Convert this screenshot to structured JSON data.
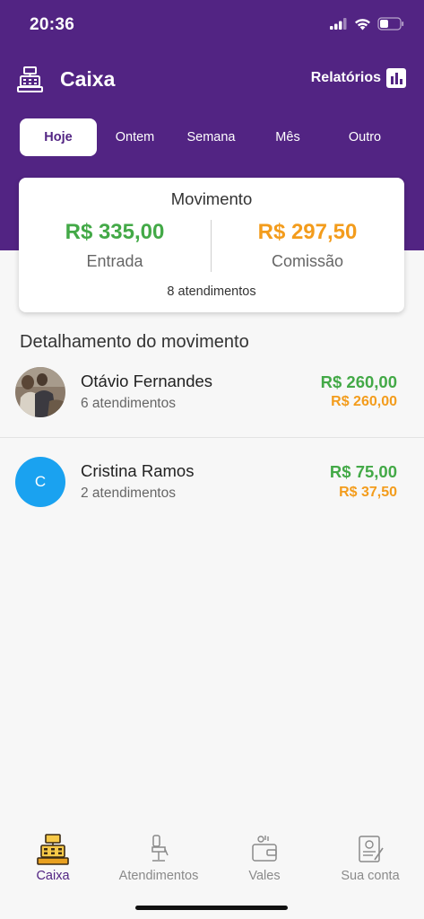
{
  "status": {
    "time": "20:36"
  },
  "app": {
    "title": "Caixa",
    "reports_label": "Relatórios"
  },
  "tabs": [
    {
      "label": "Hoje",
      "active": true
    },
    {
      "label": "Ontem"
    },
    {
      "label": "Semana"
    },
    {
      "label": "Mês"
    },
    {
      "label": "Outro"
    }
  ],
  "summary": {
    "title": "Movimento",
    "entrada_value": "R$ 335,00",
    "entrada_label": "Entrada",
    "comissao_value": "R$ 297,50",
    "comissao_label": "Comissão",
    "footer": "8 atendimentos"
  },
  "details": {
    "title": "Detalhamento do movimento",
    "items": [
      {
        "name": "Otávio Fernandes",
        "sub": "6 atendimentos",
        "value": "R$ 260,00",
        "commission": "R$ 260,00"
      },
      {
        "name": "Cristina Ramos",
        "sub": "2 atendimentos",
        "value": "R$ 75,00",
        "commission": "R$ 37,50",
        "initial": "C"
      }
    ]
  },
  "nav": [
    {
      "label": "Caixa",
      "icon": "cash-register-icon",
      "active": true
    },
    {
      "label": "Atendimentos",
      "icon": "barber-chair-icon"
    },
    {
      "label": "Vales",
      "icon": "wallet-icon"
    },
    {
      "label": "Sua conta",
      "icon": "account-document-icon"
    }
  ],
  "colors": {
    "brand": "#522483",
    "green": "#43a947",
    "orange": "#f39c1c",
    "avatar_blue": "#1aa2f0"
  }
}
